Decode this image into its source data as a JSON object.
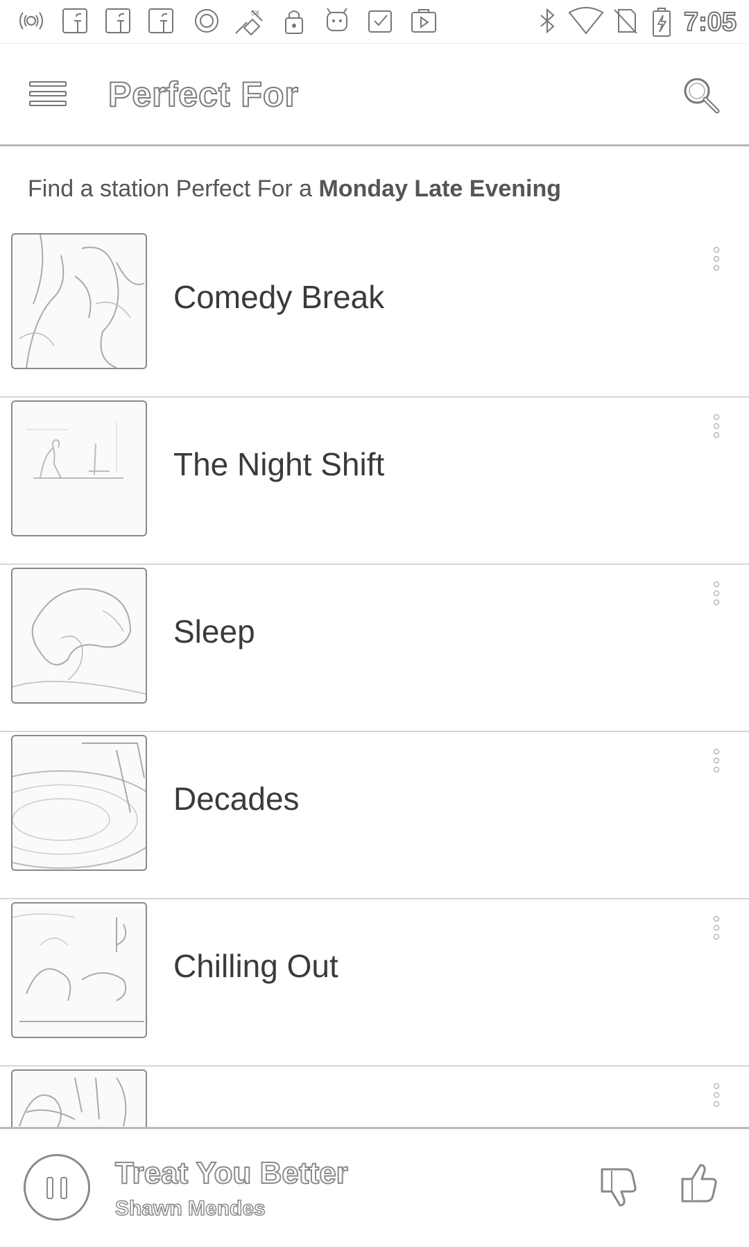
{
  "status_bar": {
    "time": "7:05",
    "left_icons": [
      "radio-app-icon",
      "facebook-icon",
      "facebook-icon",
      "facebook-icon",
      "circle-app-icon",
      "satellite-icon",
      "lock-icon",
      "android-icon",
      "clipboard-check-icon",
      "play-store-icon"
    ],
    "right_icons": [
      "bluetooth-icon",
      "wifi-icon",
      "no-sim-icon",
      "battery-charging-icon"
    ]
  },
  "app_bar": {
    "title": "Perfect For",
    "menu_icon": "hamburger-menu-icon",
    "search_icon": "search-icon"
  },
  "subtitle": {
    "prefix": "Find a station Perfect For a ",
    "highlight": "Monday Late Evening"
  },
  "stations": [
    {
      "label": "Comedy Break"
    },
    {
      "label": "The Night Shift"
    },
    {
      "label": "Sleep"
    },
    {
      "label": "Decades"
    },
    {
      "label": "Chilling Out"
    },
    {
      "label": ""
    }
  ],
  "now_playing": {
    "title": "Treat You Better",
    "artist": "Shawn Mendes"
  },
  "colors": {
    "background": "#ffffff",
    "divider": "#d6d6d6",
    "text": "#3a3a3a"
  }
}
